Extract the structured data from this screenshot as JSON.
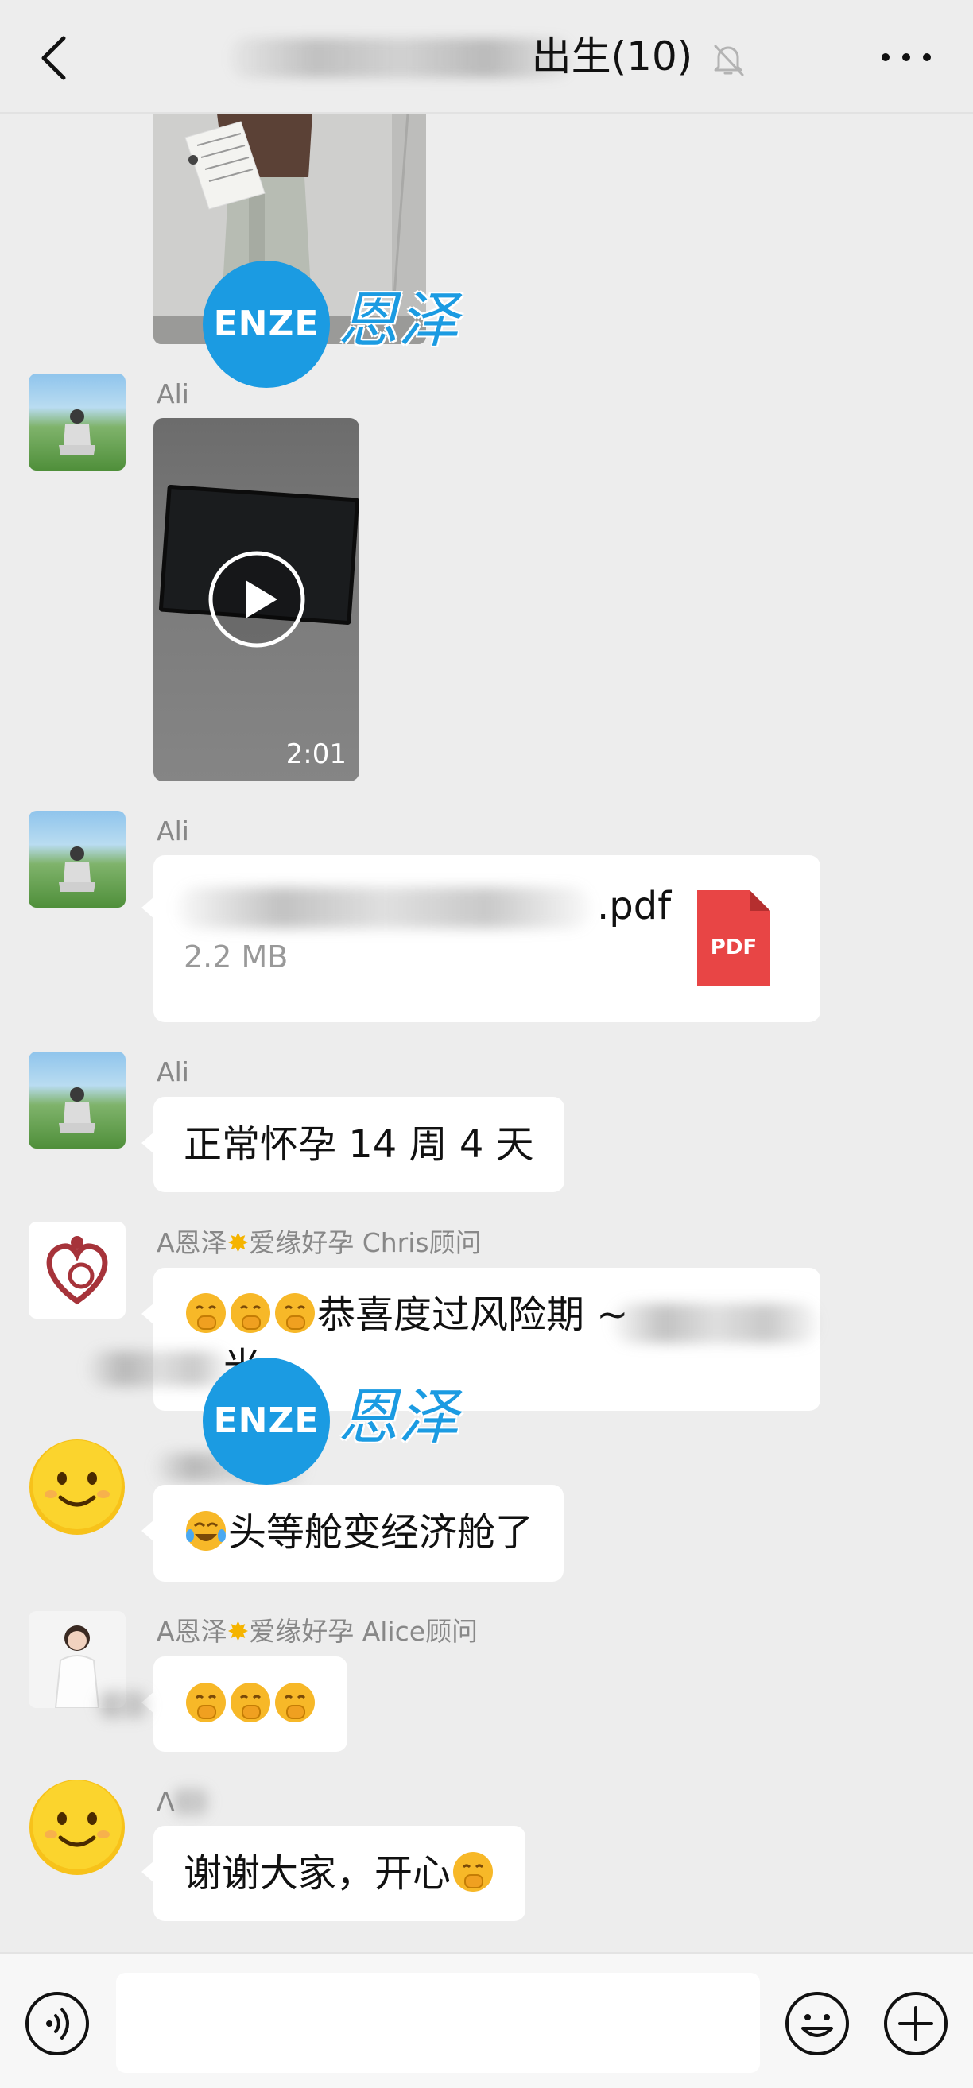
{
  "header": {
    "title": "出生(10)",
    "back_icon": "chevron-left-icon",
    "mute_icon": "bell-slash-icon",
    "more_icon": "more-dots-icon"
  },
  "watermark": {
    "logo_text": "ENZE",
    "brand_text": "恩泽",
    "color": "#1b9be2"
  },
  "messages": [
    {
      "id": "photo",
      "type": "image"
    },
    {
      "id": "video",
      "sender": "Ali",
      "type": "video",
      "duration": "2:01"
    },
    {
      "id": "file",
      "sender": "Ali",
      "type": "file",
      "file_name_suffix": ".pdf",
      "file_size": "2.2 MB",
      "file_badge": "PDF"
    },
    {
      "id": "text1",
      "sender": "Ali",
      "type": "text",
      "text": "正常怀孕 14 周 4 天"
    },
    {
      "id": "text2",
      "sender_prefix": "A恩泽",
      "sender_suffix": "爱缘好孕 Chris顾问",
      "type": "text",
      "text": "恭喜度过风险期 ~",
      "text_line2": "光"
    },
    {
      "id": "text3",
      "type": "text",
      "text": "头等舱变经济舱了"
    },
    {
      "id": "text4",
      "sender_prefix": "A恩泽",
      "sender_suffix": "爱缘好孕 Alice顾问",
      "type": "text"
    },
    {
      "id": "text5",
      "sender_initial": "Λ",
      "type": "text",
      "text": "谢谢大家，开心"
    }
  ],
  "input_bar": {
    "voice_icon": "voice-icon",
    "emoji_icon": "emoji-icon",
    "plus_icon": "plus-icon"
  },
  "colors": {
    "background": "#ededed",
    "bubble": "#ffffff",
    "pdf_red": "#e84545"
  }
}
